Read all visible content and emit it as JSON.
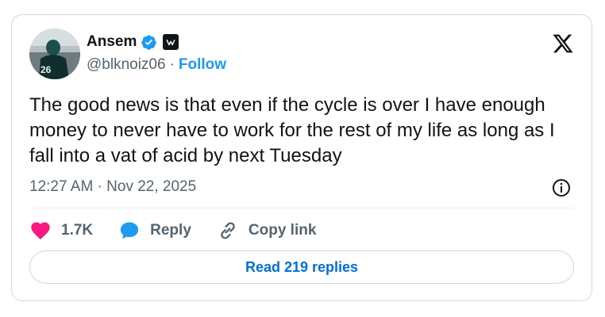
{
  "author": {
    "name": "Ansem",
    "handle": "@blknoiz06",
    "follow_label": "Follow",
    "avatar_jersey_number": "26"
  },
  "icons": {
    "verified": "verified-badge-icon",
    "affiliation": "affiliation-badge-icon",
    "logo": "x-logo-icon",
    "info": "info-icon",
    "like": "heart-icon",
    "reply": "speech-bubble-icon",
    "copy": "link-icon"
  },
  "colors": {
    "accent": "#1d9bf0",
    "like": "#f91880",
    "link_text": "#006fd6",
    "muted": "#536471"
  },
  "tweet": {
    "text": "The good news is that even if the cycle is over I have enough money to never have to work for the rest of my life as long as I fall into a vat of acid by next Tuesday",
    "timestamp": "12:27 AM · Nov 22, 2025"
  },
  "actions": {
    "likes": "1.7K",
    "reply_label": "Reply",
    "copy_label": "Copy link"
  },
  "replies_button": "Read 219 replies"
}
